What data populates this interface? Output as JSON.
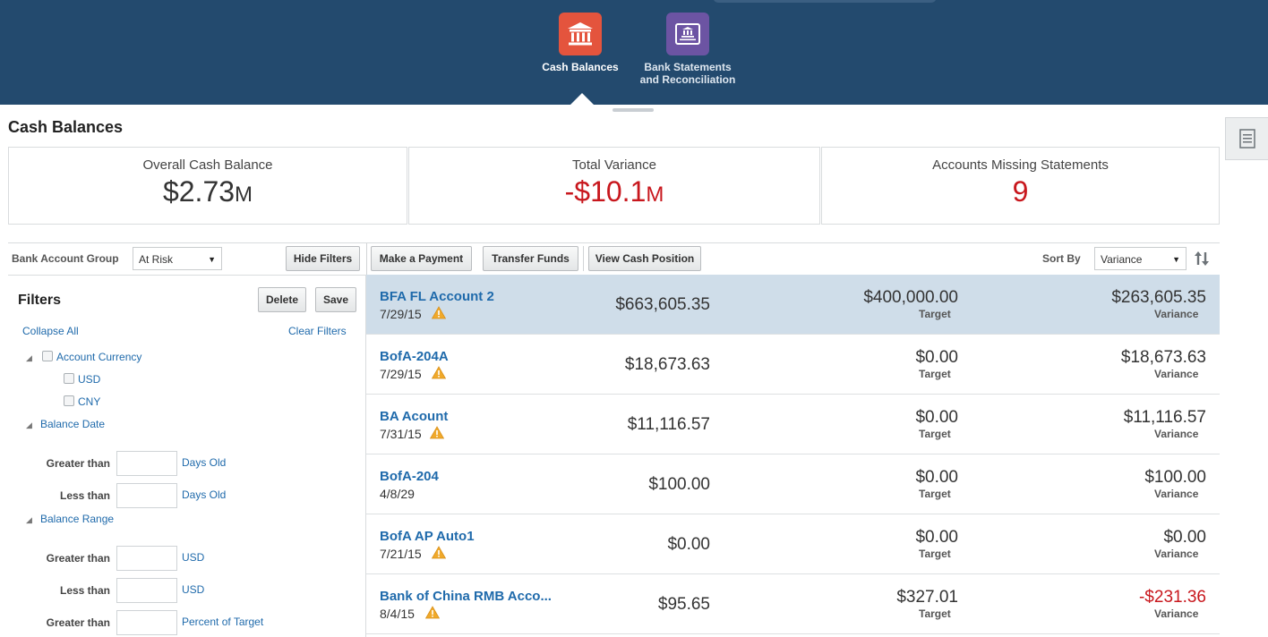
{
  "nav": {
    "apps": [
      {
        "label": "Cash Balances",
        "color": "#e4543d",
        "icon": "bank-icon"
      },
      {
        "label_line1": "Bank Statements",
        "label_line2": "and Reconciliation",
        "color": "#6c54a3",
        "icon": "statement-icon"
      }
    ]
  },
  "page": {
    "title": "Cash Balances"
  },
  "kpis": [
    {
      "label": "Overall Cash Balance",
      "value": "$2.73",
      "unit": "M"
    },
    {
      "label": "Total Variance",
      "value": "-$10.1",
      "unit": "M",
      "color": "#c8171d"
    },
    {
      "label": "Accounts Missing Statements",
      "value": "9",
      "color": "#c8171d"
    }
  ],
  "toolbar": {
    "group_label": "Bank Account Group",
    "group_value": "At Risk",
    "hide_filters": "Hide Filters",
    "make_payment": "Make a Payment",
    "transfer_funds": "Transfer Funds",
    "view_cash_position": "View Cash Position",
    "sort_label": "Sort By",
    "sort_value": "Variance"
  },
  "filters": {
    "title": "Filters",
    "delete": "Delete",
    "save": "Save",
    "collapse_all": "Collapse All",
    "clear_filters": "Clear Filters",
    "currency": {
      "label": "Account Currency",
      "options": [
        "USD",
        "CNY"
      ]
    },
    "balance_date": {
      "label": "Balance Date",
      "greater_than": "Greater than",
      "greater_unit": "Days Old",
      "less_than": "Less than",
      "less_unit": "Days Old"
    },
    "balance_range": {
      "label": "Balance Range",
      "greater_than": "Greater than",
      "greater_unit": "USD",
      "less_than": "Less than",
      "less_unit": "USD",
      "greater_than2": "Greater than",
      "greater_unit2": "Percent of Target"
    }
  },
  "list": {
    "target_label": "Target",
    "variance_label": "Variance",
    "rows": [
      {
        "name": "BFA FL Account 2",
        "date": "7/29/15",
        "warning": true,
        "balance": "$663,605.35",
        "target": "$400,000.00",
        "variance": "$263,605.35",
        "negative": false,
        "selected": true
      },
      {
        "name": "BofA-204A",
        "date": "7/29/15",
        "warning": true,
        "balance": "$18,673.63",
        "target": "$0.00",
        "variance": "$18,673.63",
        "negative": false,
        "selected": false
      },
      {
        "name": "BA Acount",
        "date": "7/31/15",
        "warning": true,
        "balance": "$11,116.57",
        "target": "$0.00",
        "variance": "$11,116.57",
        "negative": false,
        "selected": false
      },
      {
        "name": "BofA-204",
        "date": "4/8/29",
        "warning": false,
        "balance": "$100.00",
        "target": "$0.00",
        "variance": "$100.00",
        "negative": false,
        "selected": false
      },
      {
        "name": "BofA AP Auto1",
        "date": "7/21/15",
        "warning": true,
        "balance": "$0.00",
        "target": "$0.00",
        "variance": "$0.00",
        "negative": false,
        "selected": false
      },
      {
        "name": "Bank of China RMB Acco...",
        "date": "8/4/15",
        "warning": true,
        "balance": "$95.65",
        "target": "$327.01",
        "variance": "-$231.36",
        "negative": true,
        "selected": false
      }
    ]
  }
}
